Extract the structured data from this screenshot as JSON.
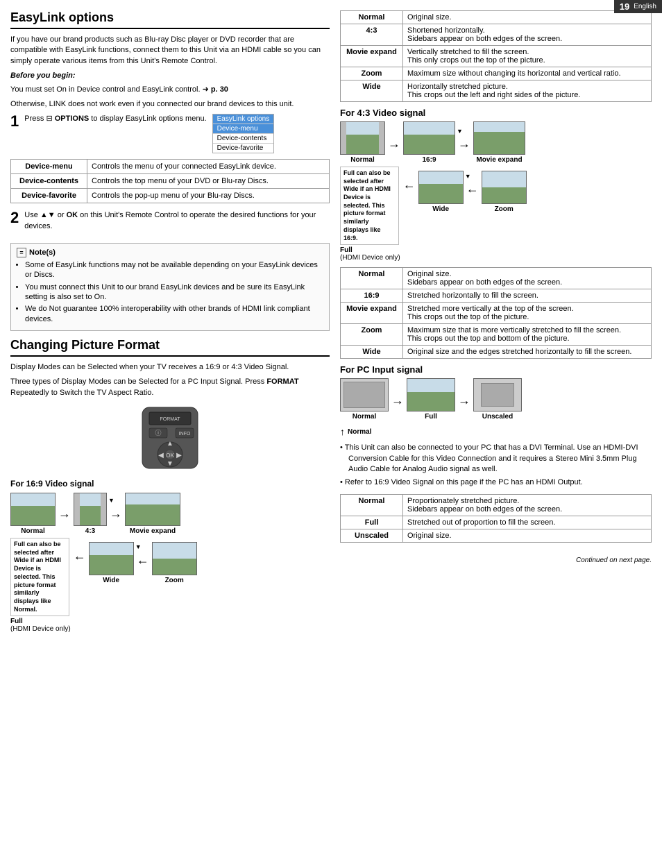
{
  "page": {
    "number": "19",
    "language": "English"
  },
  "easylink": {
    "title": "EasyLink options",
    "intro": "If you have our brand products such as Blu-ray Disc player or DVD recorder that are compatible with EasyLink functions, connect them to this Unit via an HDMI cable so you can simply operate various items from this Unit's Remote Control.",
    "before_begin_label": "Before you begin:",
    "before_begin_text1": "You must set On in Device control and EasyLink control.",
    "before_begin_arrow": "→",
    "before_begin_page": "p. 30",
    "before_begin_text2": "Otherwise, LINK does not work even if you connected our brand devices to this unit.",
    "step1_number": "1",
    "step1_text": "Press",
    "step1_options_icon": "⊟",
    "step1_options_label": "OPTIONS",
    "step1_text2": "to display EasyLink options menu.",
    "popup": {
      "title": "EasyLink options",
      "items": [
        "Device-menu",
        "Device-contents",
        "Device-favorite"
      ],
      "selected": 0
    },
    "table": [
      {
        "label": "Device-menu",
        "description": "Controls the menu of your connected EasyLink device."
      },
      {
        "label": "Device-contents",
        "description": "Controls the top menu of your DVD or Blu-ray Discs."
      },
      {
        "label": "Device-favorite",
        "description": "Controls the pop-up menu of your Blu-ray Discs."
      }
    ],
    "step2_number": "2",
    "step2_text": "Use ▲▼ or OK on this Unit's Remote Control to operate the desired functions for your devices.",
    "notes_header": "Note(s)",
    "notes": [
      "Some of EasyLink functions may not be available depending on your EasyLink devices or Discs.",
      "You must connect this Unit to our brand EasyLink devices and be sure its EasyLink setting is also set to On.",
      "We do Not guarantee 100% interoperability with other brands of HDMI link compliant devices."
    ]
  },
  "changing_picture": {
    "title": "Changing Picture Format",
    "intro1": "Display Modes can be Selected when your TV receives a 16:9 or 4:3 Video Signal.",
    "intro2": "Three types of Display Modes can be Selected for a PC Input Signal. Press FORMAT Repeatedly to Switch the TV Aspect Ratio.",
    "signal_16_9_title": "For 16:9 Video signal",
    "diagrams_16_9": {
      "row1": [
        {
          "id": "normal-16-9",
          "label": "Normal",
          "type": "normal"
        },
        {
          "id": "arrow1",
          "type": "arrow"
        },
        {
          "id": "4-3",
          "label": "4:3",
          "type": "sidebar"
        },
        {
          "id": "arrow2",
          "type": "arrow"
        },
        {
          "id": "movie-expand-16-9",
          "label": "Movie expand",
          "type": "wide",
          "has_indicator": true
        }
      ],
      "caption_box": "Full can also be selected after Wide if an HDMI Device is selected. This picture format similarly displays like Normal.",
      "row2": [
        {
          "id": "full-16-9",
          "label": "Full\n(HDMI Device only)",
          "type": "normal"
        },
        {
          "id": "arrow3",
          "type": "arrow_left"
        },
        {
          "id": "wide-16-9",
          "label": "Wide",
          "type": "normal_wide"
        },
        {
          "id": "arrow4",
          "type": "arrow_left"
        },
        {
          "id": "zoom-16-9",
          "label": "Zoom",
          "type": "zoom"
        }
      ]
    }
  },
  "right_column": {
    "table_16_9": [
      {
        "label": "Normal",
        "description": "Original size."
      },
      {
        "label": "4:3",
        "description": "Shortened horizontally.\nSidebars appear on both edges of the screen."
      },
      {
        "label": "Movie expand",
        "description": "Vertically stretched to fill the screen.\nThis only crops out the top of the picture."
      },
      {
        "label": "Zoom",
        "description": "Maximum size without changing its horizontal and vertical ratio."
      },
      {
        "label": "Wide",
        "description": "Horizontally stretched picture.\nThis crops out the left and right sides of the picture."
      }
    ],
    "signal_4_3_title": "For 4:3 Video signal",
    "table_4_3": [
      {
        "label": "Normal",
        "description": "Original size.\nSidebars appear on both edges of the screen."
      },
      {
        "label": "16:9",
        "description": "Stretched horizontally to fill the screen."
      },
      {
        "label": "Movie expand",
        "description": "Stretched more vertically at the top of the screen.\nThis crops out the top of the picture."
      },
      {
        "label": "Zoom",
        "description": "Maximum size that is more vertically stretched to fill the screen.\nThis crops out the top and bottom of the picture."
      },
      {
        "label": "Wide",
        "description": "Original size and the edges stretched horizontally to fill the screen."
      }
    ],
    "signal_pc_title": "For PC Input signal",
    "bullet1": "• This Unit can also be connected to your PC that has a DVI Terminal. Use an HDMI-DVI Conversion Cable for this Video Connection and it requires a Stereo Mini 3.5mm Plug Audio Cable for Analog Audio signal as well.",
    "bullet2": "• Refer to 16:9 Video Signal on this page if the PC has an HDMI Output.",
    "table_pc": [
      {
        "label": "Normal",
        "description": "Proportionately stretched picture.\nSidebars appear on both edges of the screen."
      },
      {
        "label": "Full",
        "description": "Stretched out of proportion to fill the screen."
      },
      {
        "label": "Unscaled",
        "description": "Original size."
      }
    ],
    "continued": "Continued on next page."
  },
  "diagrams_4_3": {
    "row1_labels": [
      "Normal",
      "16:9",
      "Movie expand"
    ],
    "row2_labels": [
      "Full\n(HDMI Device only)",
      "Wide",
      "Zoom"
    ],
    "caption_box": "Full can also be selected after Wide if an HDMI Device is selected. This picture format similarly displays like 16:9."
  },
  "diagrams_pc": {
    "labels": [
      "Normal",
      "Full",
      "Unscaled"
    ]
  }
}
